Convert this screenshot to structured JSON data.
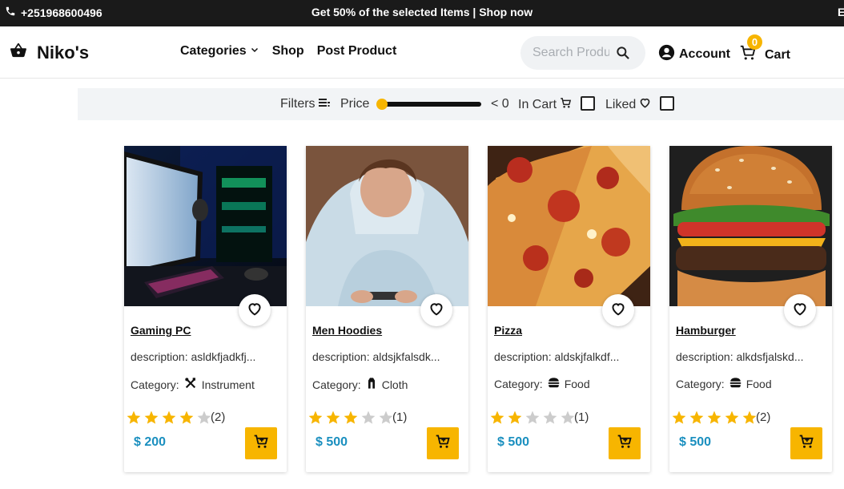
{
  "topbar": {
    "phone": "+251968600496",
    "promo": "Get 50% of the selected Items | Shop now",
    "edge_text": "E"
  },
  "nav": {
    "brand": "Niko's",
    "links": {
      "categories": "Categories",
      "shop": "Shop",
      "post_product": "Post Product"
    },
    "search_placeholder": "Search Products",
    "account": "Account",
    "cart": "Cart",
    "cart_count": "0"
  },
  "filters": {
    "filters_label": "Filters",
    "price_label": "Price",
    "price_value": "< 0",
    "price_slider_fraction": 0,
    "in_cart_label": "In Cart",
    "liked_label": "Liked"
  },
  "category_prefix": "Category:",
  "products": [
    {
      "title": "Gaming PC",
      "description": "description: asldkfjadkfj...",
      "category": "Instrument",
      "category_icon": "tools-icon",
      "rating": 4,
      "reviews": "(2)",
      "price": "$ 200"
    },
    {
      "title": "Men Hoodies",
      "description": "description: aldsjkfalsdk...",
      "category": "Cloth",
      "category_icon": "cloth-icon",
      "rating": 3,
      "reviews": "(1)",
      "price": "$ 500"
    },
    {
      "title": "Pizza",
      "description": "description: aldskjfalkdf...",
      "category": "Food",
      "category_icon": "burger-icon",
      "rating": 2,
      "reviews": "(1)",
      "price": "$ 500"
    },
    {
      "title": "Hamburger",
      "description": "description: alkdsfjalskd...",
      "category": "Food",
      "category_icon": "burger-icon",
      "rating": 5,
      "reviews": "(2)",
      "price": "$ 500"
    }
  ],
  "colors": {
    "accent": "#f7b500",
    "price": "#1a8fbf",
    "topbar": "#1a1a1a",
    "star_empty": "#cccccc"
  }
}
